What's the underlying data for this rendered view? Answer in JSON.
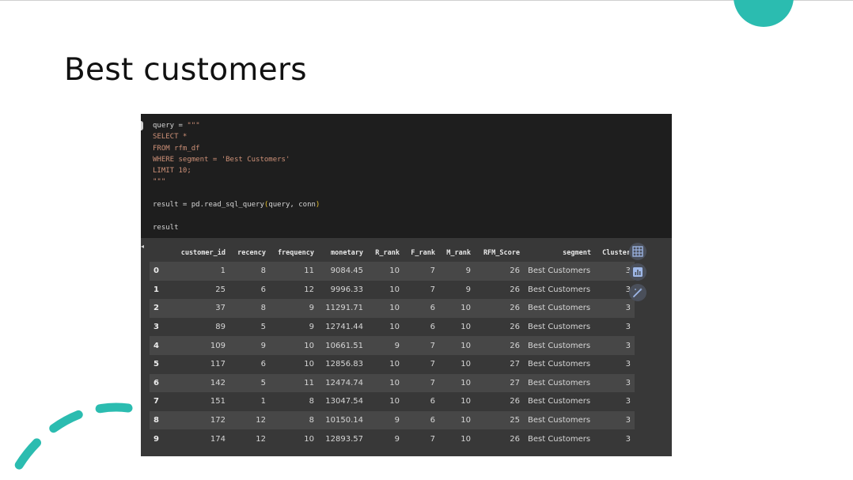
{
  "slide": {
    "title": "Best customers"
  },
  "code_cell": {
    "lines": {
      "l1a": "query = ",
      "l1b": "\"\"\"",
      "l2": "SELECT *",
      "l3": "FROM rfm_df",
      "l4": "WHERE segment = 'Best Customers'",
      "l5": "LIMIT 10;",
      "l6": "\"\"\"",
      "l8a": "result = pd.read_sql_query",
      "l8b": "(",
      "l8c": "query, conn",
      "l8d": ")",
      "l10": "result"
    }
  },
  "dataframe": {
    "columns": [
      "customer_id",
      "recency",
      "frequency",
      "monetary",
      "R_rank",
      "F_rank",
      "M_rank",
      "RFM_Score",
      "segment",
      "Cluster"
    ],
    "rows": [
      [
        "0",
        "1",
        "8",
        "11",
        "9084.45",
        "10",
        "7",
        "9",
        "26",
        "Best Customers",
        "3"
      ],
      [
        "1",
        "25",
        "6",
        "12",
        "9996.33",
        "10",
        "7",
        "9",
        "26",
        "Best Customers",
        "3"
      ],
      [
        "2",
        "37",
        "8",
        "9",
        "11291.71",
        "10",
        "6",
        "10",
        "26",
        "Best Customers",
        "3"
      ],
      [
        "3",
        "89",
        "5",
        "9",
        "12741.44",
        "10",
        "6",
        "10",
        "26",
        "Best Customers",
        "3"
      ],
      [
        "4",
        "109",
        "9",
        "10",
        "10661.51",
        "9",
        "7",
        "10",
        "26",
        "Best Customers",
        "3"
      ],
      [
        "5",
        "117",
        "6",
        "10",
        "12856.83",
        "10",
        "7",
        "10",
        "27",
        "Best Customers",
        "3"
      ],
      [
        "6",
        "142",
        "5",
        "11",
        "12474.74",
        "10",
        "7",
        "10",
        "27",
        "Best Customers",
        "3"
      ],
      [
        "7",
        "151",
        "1",
        "8",
        "13047.54",
        "10",
        "6",
        "10",
        "26",
        "Best Customers",
        "3"
      ],
      [
        "8",
        "172",
        "12",
        "8",
        "10150.14",
        "9",
        "6",
        "10",
        "25",
        "Best Customers",
        "3"
      ],
      [
        "9",
        "174",
        "12",
        "10",
        "12893.57",
        "9",
        "7",
        "10",
        "26",
        "Best Customers",
        "3"
      ]
    ]
  },
  "output_toolbar": {
    "icons": [
      "table-view-icon",
      "chart-suggest-icon",
      "magic-wand-icon"
    ]
  },
  "colors": {
    "accent_teal": "#2bbcb0",
    "code_bg": "#1e1e1e",
    "output_bg": "#383838",
    "string_color": "#ce9178"
  }
}
